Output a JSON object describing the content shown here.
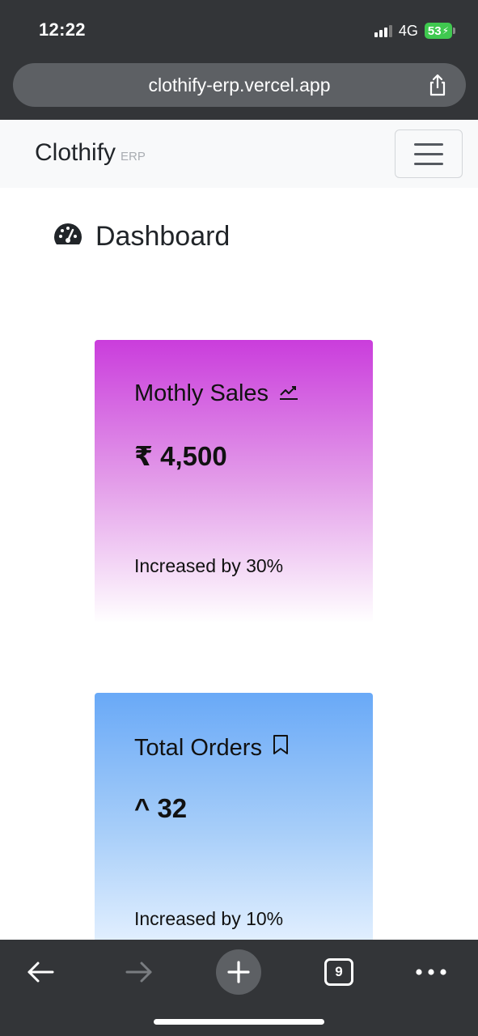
{
  "status_bar": {
    "time": "12:22",
    "network": "4G",
    "battery": "53"
  },
  "browser": {
    "url": "clothify-erp.vercel.app",
    "tab_count": "9"
  },
  "navbar": {
    "brand": "Clothify",
    "brand_sub": "ERP"
  },
  "page": {
    "title": "Dashboard",
    "icon": "speedometer-icon"
  },
  "cards": [
    {
      "title": "Mothly Sales",
      "icon": "graph-up-icon",
      "value": "₹ 4,500",
      "footer": "Increased by 30%",
      "gradient_top": "#ca3ddc",
      "gradient_bottom": "#ffffff"
    },
    {
      "title": "Total Orders",
      "icon": "bookmark-icon",
      "value": "^ 32",
      "footer": "Increased by 10%",
      "gradient_top": "#69a9f7",
      "gradient_bottom": "#e7f2ff"
    }
  ],
  "colors": {
    "chrome": "#333538",
    "url_bar": "#5d6064",
    "navbar_bg": "#f8f9fa",
    "battery_green": "#3fc94f"
  }
}
